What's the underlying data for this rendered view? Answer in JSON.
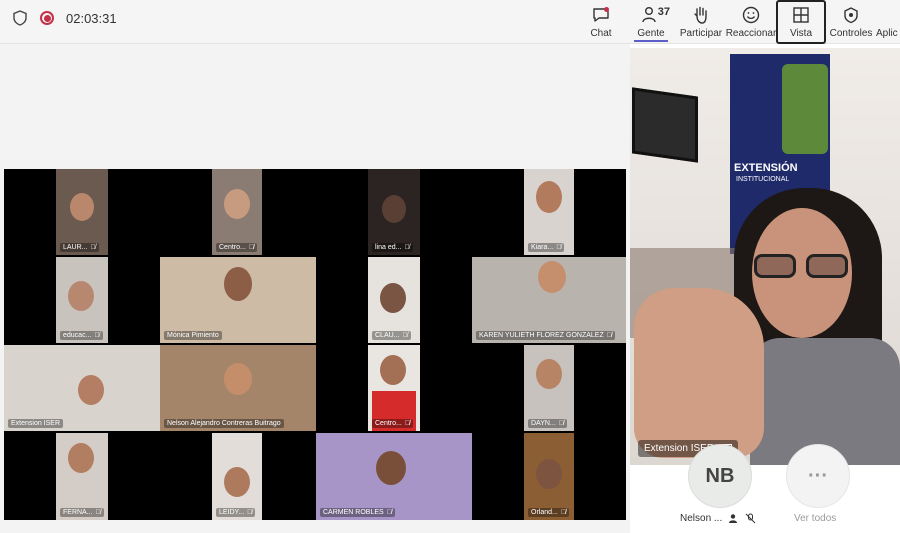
{
  "header": {
    "timer": "02:03:31",
    "buttons": [
      {
        "label": "Chat",
        "icon": "chat-icon"
      },
      {
        "label": "Gente",
        "icon": "people-icon",
        "count": "37"
      },
      {
        "label": "Participar",
        "icon": "raise-hand-icon"
      },
      {
        "label": "Reaccionar",
        "icon": "react-icon"
      },
      {
        "label": "Vista",
        "icon": "view-grid-icon"
      },
      {
        "label": "Controles",
        "icon": "controls-icon"
      },
      {
        "label": "Aplic",
        "icon": "apps-icon"
      }
    ]
  },
  "participants": [
    {
      "name": "LAUR..."
    },
    {
      "name": "Centro..."
    },
    {
      "name": "lina ed..."
    },
    {
      "name": "Kiara..."
    },
    {
      "name": "educac..."
    },
    {
      "name": "Mónica Pimiento"
    },
    {
      "name": "CLAU..."
    },
    {
      "name": "KAREN YULIETH FLOREZ GONZALEZ"
    },
    {
      "name": "Extension ISER"
    },
    {
      "name": "Nelson Alejandro Contreras Buitrago"
    },
    {
      "name": "Centro..."
    },
    {
      "name": "DAYN..."
    },
    {
      "name": "FERNA..."
    },
    {
      "name": "LEIDY..."
    },
    {
      "name": "CARMEN ROBLES"
    },
    {
      "name": "Orland..."
    }
  ],
  "spotlight": {
    "name": "Extension ISER",
    "banner_title": "EXTENSIÓN",
    "banner_sub": "INSTITUCIONAL"
  },
  "roster": {
    "avatar_initials": "NB",
    "avatar_name": "Nelson ...",
    "more_label": "Ver todos",
    "more_glyph": "···"
  }
}
